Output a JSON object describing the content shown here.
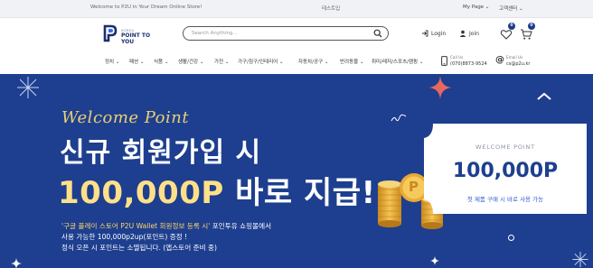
{
  "topbar": {
    "welcome": "Welcome to P2U in Your Dream Online Store!",
    "test": "테스트입",
    "mypage": "My Page ⌄",
    "cs": "고객센터 ⌄"
  },
  "header": {
    "logo_small": "KOREA",
    "logo_name": "POINT TO YOU",
    "search_placeholder": "Search Anything...",
    "login": "Login",
    "join": "Join",
    "wish_count": "0",
    "cart_count": "0"
  },
  "nav": {
    "items": [
      "정치 ⌄",
      "패션 ⌄",
      "식품 ⌄",
      "생활/건강 ⌄",
      "가전 ⌄",
      "가구/침구/인테리어 ⌄",
      "자동차/공구 ⌄",
      "반려동물 ⌄",
      "취미/레저/스포츠/캠핑 ⌄"
    ],
    "call_label": "Call Us",
    "call_number": "(070)8873-9524",
    "email_label": "Email Us",
    "email_address": "cs@p2u.kr"
  },
  "banner": {
    "script_title": "Welcome Point",
    "headline1": "신규 회원가입 시",
    "amount": "100,000P",
    "headline2_rest": " 바로 지급!",
    "desc_highlight": "'구글 플레이 스토어 P2U Wallet 회원정보 등록 시'",
    "desc_line1_rest": " 포인투유 쇼핑몰에서",
    "desc_line2": "사용 가능한 100,000p2up(포인트) 증정 !",
    "desc_line3": "정식 오픈 시 포인트는 소멸됩니다. (앱스토어 준비 중)",
    "coupon_label": "WELCOME POINT",
    "coupon_value": "100,000P",
    "coupon_sub": "첫 제품 구매 시 바로 사용 가능",
    "coin_letter": "P"
  },
  "colors": {
    "banner_bg": "#1e3f8f",
    "gold": "#e9cf74",
    "star_red": "#e8675f",
    "brand_navy": "#1a2f6e"
  },
  "icons": [
    "search-icon",
    "login-icon",
    "user-icon",
    "heart-icon",
    "cart-icon",
    "phone-icon",
    "at-icon"
  ]
}
